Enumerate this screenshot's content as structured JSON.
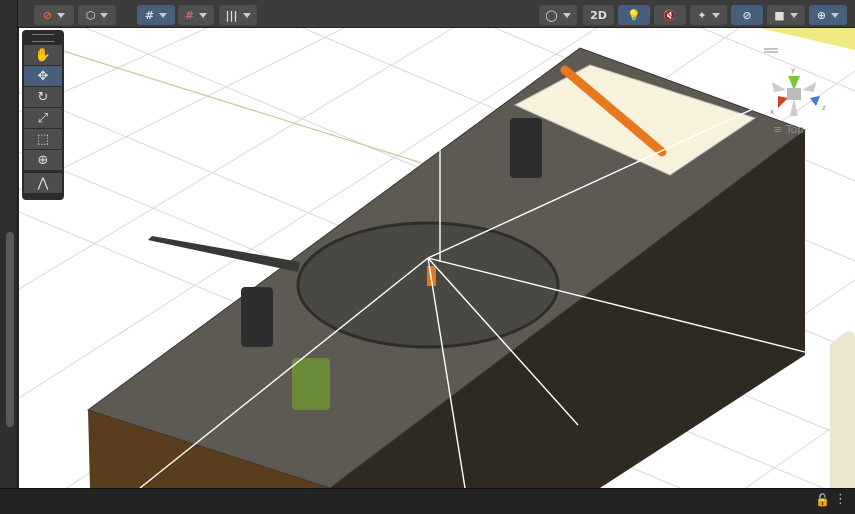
{
  "toolbar": {
    "left_tools": [
      {
        "icon": "draw-mode-icon"
      },
      {
        "icon": "shading-cube-icon"
      },
      {
        "icon": "grid-snap-icon",
        "active": true
      },
      {
        "icon": "snap-magnet-icon"
      },
      {
        "icon": "increment-snap-icon"
      }
    ],
    "right_tools": [
      {
        "icon": "render-mode-icon"
      },
      {
        "label": "2D"
      },
      {
        "icon": "lighting-icon",
        "active": true
      },
      {
        "icon": "audio-mute-icon"
      },
      {
        "icon": "effects-icon"
      },
      {
        "icon": "hidden-objects-icon",
        "active": true
      },
      {
        "icon": "camera-icon"
      },
      {
        "icon": "gizmos-icon",
        "active": true
      }
    ]
  },
  "tools": [
    {
      "name": "hand-tool",
      "glyph": "✋"
    },
    {
      "name": "move-tool",
      "glyph": "✥",
      "active": true
    },
    {
      "name": "rotate-tool",
      "glyph": "↻"
    },
    {
      "name": "scale-tool",
      "glyph": "⤢"
    },
    {
      "name": "rect-tool",
      "glyph": "⬚"
    },
    {
      "name": "transform-tool",
      "glyph": "⊕"
    },
    {
      "name": "custom-tool",
      "glyph": "⋀"
    }
  ],
  "gizmo": {
    "view_label": "Top",
    "axes": {
      "x": "x",
      "y": "y",
      "z": "z"
    }
  },
  "colors": {
    "accent": "#46607c",
    "x_axis": "#d0402a",
    "y_axis": "#7cc83a",
    "z_axis": "#3a7ae0"
  }
}
